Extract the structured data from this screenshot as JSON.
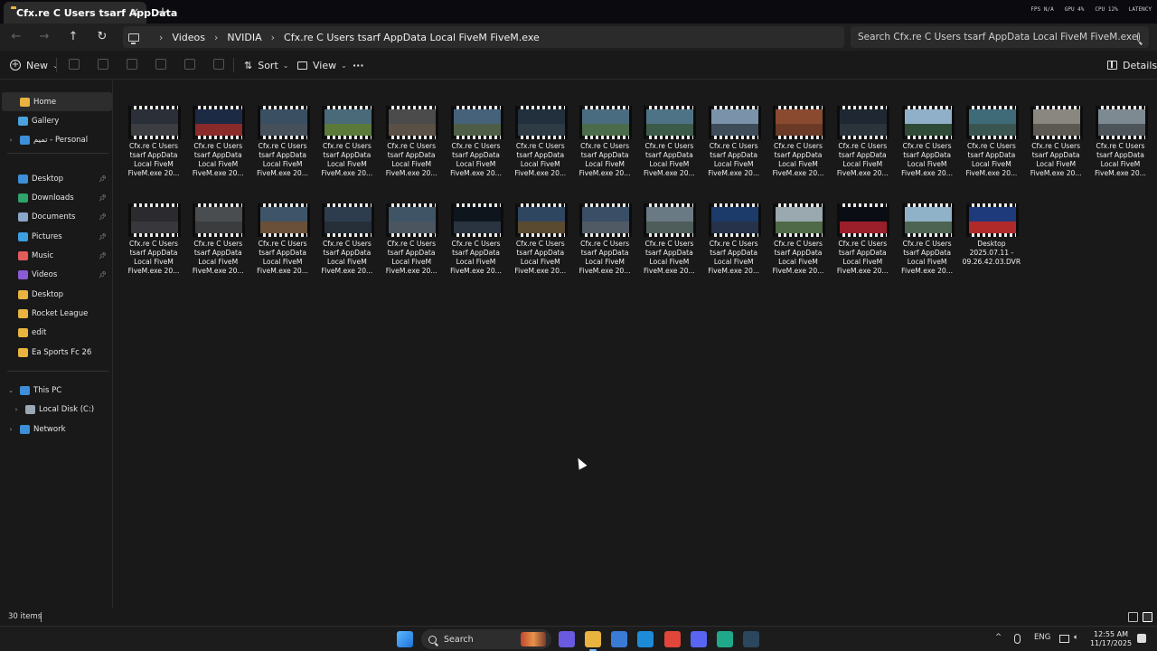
{
  "tab": {
    "title": "Cfx.re  C  Users tsarf AppData",
    "close_icon": "×",
    "new_tab_icon": "+"
  },
  "overlay": [
    "FPS N/A",
    "GPU 4%",
    "CPU 12%",
    "LATENCY"
  ],
  "nav": {
    "back": "←",
    "forward": "→",
    "up": "↑",
    "refresh": "↻"
  },
  "breadcrumb": [
    "Videos",
    "NVIDIA",
    "Cfx.re  C  Users tsarf AppData Local FiveM FiveM.exe"
  ],
  "search": {
    "placeholder": "Search Cfx.re  C  Users tsarf AppData Local FiveM FiveM.exe"
  },
  "toolbar": {
    "new_label": "New",
    "sort_label": "Sort",
    "view_label": "View",
    "more_label": "···",
    "details_label": "Details"
  },
  "sidebar": {
    "items": [
      {
        "label": "Home",
        "icon": "home-icon",
        "color": "#e8b43f"
      },
      {
        "label": "Gallery",
        "icon": "gallery-icon",
        "color": "#4aa3df"
      },
      {
        "label": "تميم - Personal",
        "icon": "onedrive-icon",
        "color": "#3c8fd8"
      },
      {
        "label": "Desktop",
        "icon": "desktop-icon",
        "color": "#3c8fd8"
      },
      {
        "label": "Downloads",
        "icon": "downloads-icon",
        "color": "#2fa36b"
      },
      {
        "label": "Documents",
        "icon": "documents-icon",
        "color": "#8aa6c8"
      },
      {
        "label": "Pictures",
        "icon": "pictures-icon",
        "color": "#3c9fe0"
      },
      {
        "label": "Music",
        "icon": "music-icon",
        "color": "#e35b5b"
      },
      {
        "label": "Videos",
        "icon": "videos-icon",
        "color": "#8b5bd6"
      },
      {
        "label": "Desktop",
        "icon": "folder-icon",
        "color": "#e8b43f"
      },
      {
        "label": "Rocket League",
        "icon": "folder-icon",
        "color": "#e8b43f"
      },
      {
        "label": "edit",
        "icon": "folder-icon",
        "color": "#e8b43f"
      },
      {
        "label": "Ea Sports Fc 26",
        "icon": "folder-icon",
        "color": "#e8b43f"
      },
      {
        "label": "This PC",
        "icon": "pc-icon",
        "color": "#3c8fd8"
      },
      {
        "label": "Local Disk (C:)",
        "icon": "drive-icon",
        "color": "#9aa8b5"
      },
      {
        "label": "Network",
        "icon": "network-icon",
        "color": "#3c8fd8"
      }
    ]
  },
  "files": [
    {
      "name": "Cfx.re  C  Users\ntsarf AppData\nLocal FiveM\nFiveM.exe 20...",
      "sky": "#2a2f38",
      "ground": "#3b3d40"
    },
    {
      "name": "Cfx.re  C  Users\ntsarf AppData\nLocal FiveM\nFiveM.exe 20...",
      "sky": "#1d2a44",
      "ground": "#8a2a2a"
    },
    {
      "name": "Cfx.re  C  Users\ntsarf AppData\nLocal FiveM\nFiveM.exe 20...",
      "sky": "#3b4f63",
      "ground": "#46505a"
    },
    {
      "name": "Cfx.re  C  Users\ntsarf AppData\nLocal FiveM\nFiveM.exe 20...",
      "sky": "#4a6a7a",
      "ground": "#5b7a3a"
    },
    {
      "name": "Cfx.re  C  Users\ntsarf AppData\nLocal FiveM\nFiveM.exe 20...",
      "sky": "#4b4b4b",
      "ground": "#5a5045"
    },
    {
      "name": "Cfx.re  C  Users\ntsarf AppData\nLocal FiveM\nFiveM.exe 20...",
      "sky": "#45627a",
      "ground": "#4e5e46"
    },
    {
      "name": "Cfx.re  C  Users\ntsarf AppData\nLocal FiveM\nFiveM.exe 20...",
      "sky": "#22303e",
      "ground": "#2e3a44"
    },
    {
      "name": "Cfx.re  C  Users\ntsarf AppData\nLocal FiveM\nFiveM.exe 20...",
      "sky": "#4a6c80",
      "ground": "#4b6c4a"
    },
    {
      "name": "Cfx.re  C  Users\ntsarf AppData\nLocal FiveM\nFiveM.exe 20...",
      "sky": "#4f7386",
      "ground": "#3b5a48"
    },
    {
      "name": "Cfx.re  C  Users\ntsarf AppData\nLocal FiveM\nFiveM.exe 20...",
      "sky": "#7a93aa",
      "ground": "#3e4c5a"
    },
    {
      "name": "Cfx.re  C  Users\ntsarf AppData\nLocal FiveM\nFiveM.exe 20...",
      "sky": "#8a4a30",
      "ground": "#6a3a26"
    },
    {
      "name": "Cfx.re  C  Users\ntsarf AppData\nLocal FiveM\nFiveM.exe 20...",
      "sky": "#1f2733",
      "ground": "#2b333b"
    },
    {
      "name": "Cfx.re  C  Users\ntsarf AppData\nLocal FiveM\nFiveM.exe 20...",
      "sky": "#8fb0c8",
      "ground": "#2f4a36"
    },
    {
      "name": "Cfx.re  C  Users\ntsarf AppData\nLocal FiveM\nFiveM.exe 20...",
      "sky": "#3f6a78",
      "ground": "#3a5550"
    },
    {
      "name": "Cfx.re  C  Users\ntsarf AppData\nLocal FiveM\nFiveM.exe 20...",
      "sky": "#8a8680",
      "ground": "#5c5852"
    },
    {
      "name": "Cfx.re  C  Users\ntsarf AppData\nLocal FiveM\nFiveM.exe 20...",
      "sky": "#7e8a92",
      "ground": "#4e555a"
    },
    {
      "name": "Cfx.re  C  Users\ntsarf AppData\nLocal FiveM\nFiveM.exe 20...",
      "sky": "#2b2b2f",
      "ground": "#38383c"
    },
    {
      "name": "Cfx.re  C  Users\ntsarf AppData\nLocal FiveM\nFiveM.exe 20...",
      "sky": "#4a4d50",
      "ground": "#3a3c3e"
    },
    {
      "name": "Cfx.re  C  Users\ntsarf AppData\nLocal FiveM\nFiveM.exe 20...",
      "sky": "#3e5468",
      "ground": "#6a5038"
    },
    {
      "name": "Cfx.re  C  Users\ntsarf AppData\nLocal FiveM\nFiveM.exe 20...",
      "sky": "#2e3d4e",
      "ground": "#262f38"
    },
    {
      "name": "Cfx.re  C  Users\ntsarf AppData\nLocal FiveM\nFiveM.exe 20...",
      "sky": "#3f5566",
      "ground": "#4a5560"
    },
    {
      "name": "Cfx.re  C  Users\ntsarf AppData\nLocal FiveM\nFiveM.exe 20...",
      "sky": "#0f151d",
      "ground": "#2a3440"
    },
    {
      "name": "Cfx.re  C  Users\ntsarf AppData\nLocal FiveM\nFiveM.exe 20...",
      "sky": "#2e4660",
      "ground": "#5a4a30"
    },
    {
      "name": "Cfx.re  C  Users\ntsarf AppData\nLocal FiveM\nFiveM.exe 20...",
      "sky": "#3a4e66",
      "ground": "#505a64"
    },
    {
      "name": "Cfx.re  C  Users\ntsarf AppData\nLocal FiveM\nFiveM.exe 20...",
      "sky": "#6a7a84",
      "ground": "#4e5c5a"
    },
    {
      "name": "Cfx.re  C  Users\ntsarf AppData\nLocal FiveM\nFiveM.exe 20...",
      "sky": "#1c3b6a",
      "ground": "#25324a"
    },
    {
      "name": "Cfx.re  C  Users\ntsarf AppData\nLocal FiveM\nFiveM.exe 20...",
      "sky": "#9aa8b0",
      "ground": "#4f6a46"
    },
    {
      "name": "Cfx.re  C  Users\ntsarf AppData\nLocal FiveM\nFiveM.exe 20...",
      "sky": "#0a0d14",
      "ground": "#9a1f2a"
    },
    {
      "name": "Cfx.re  C  Users\ntsarf AppData\nLocal FiveM\nFiveM.exe 20...",
      "sky": "#8fb2c8",
      "ground": "#4e6452"
    },
    {
      "name": "Desktop\n2025.07.11 -\n09.26.42.03.DVR",
      "sky": "#1f3a7a",
      "ground": "#b02a2a"
    }
  ],
  "status": {
    "item_count": "30 items"
  },
  "taskbar": {
    "search_label": "Search",
    "tray_lang": "ENG",
    "tray_chevron": "^",
    "clock_time": "12:55 AM",
    "clock_date": "11/17/2025",
    "apps": [
      {
        "name": "start-icon",
        "color": "#2f8fe8"
      },
      {
        "name": "copilot-icon",
        "color": "#6a5ae0"
      },
      {
        "name": "file-explorer-icon",
        "color": "#e8b43f"
      },
      {
        "name": "store-icon",
        "color": "#3a7bd5"
      },
      {
        "name": "edge-icon",
        "color": "#1d8bd8"
      },
      {
        "name": "chrome-icon",
        "color": "#e0463a"
      },
      {
        "name": "discord-icon",
        "color": "#5865f2"
      },
      {
        "name": "spotify-like-icon",
        "color": "#1fa88a"
      },
      {
        "name": "steam-icon",
        "color": "#2a475e"
      }
    ]
  }
}
